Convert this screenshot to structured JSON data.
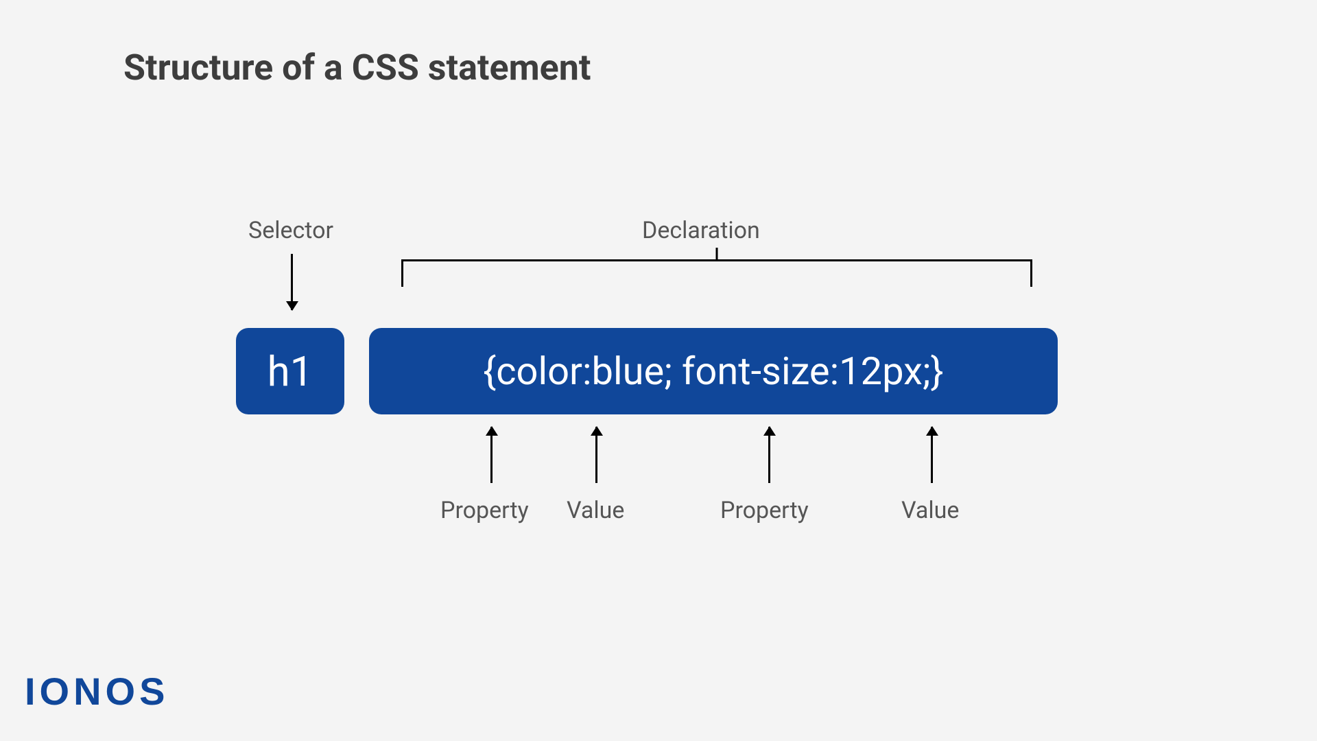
{
  "title": "Structure of a CSS statement",
  "labels": {
    "selector": "Selector",
    "declaration": "Declaration",
    "property1": "Property",
    "value1": "Value",
    "property2": "Property",
    "value2": "Value"
  },
  "code": {
    "selector": "h1",
    "declaration": "{color:blue; font-size:12px;}"
  },
  "brand": "IONOS"
}
